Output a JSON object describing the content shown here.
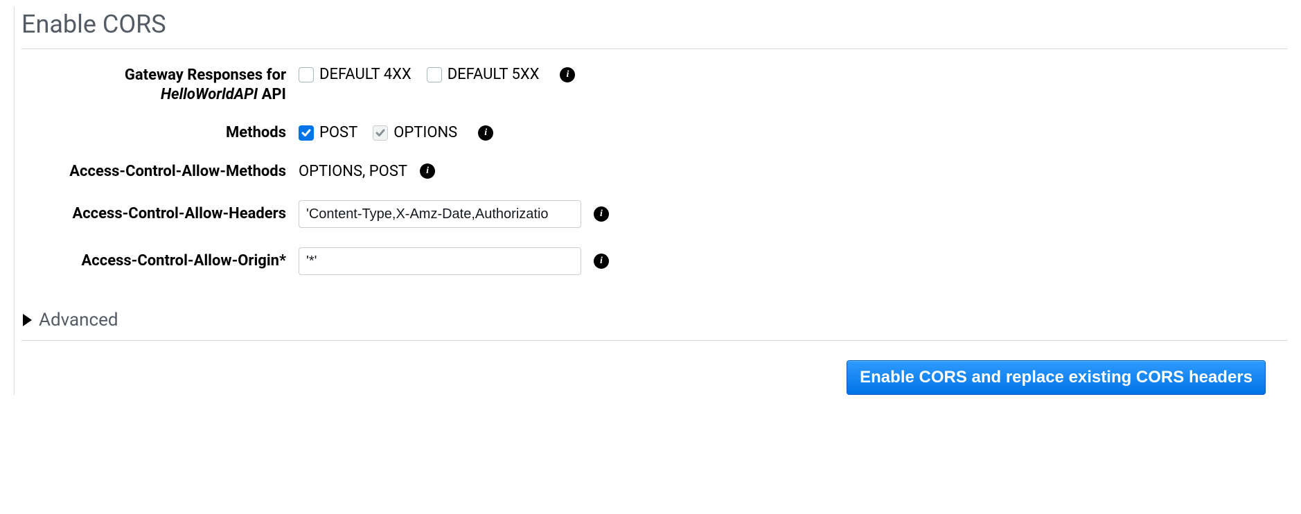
{
  "title": "Enable CORS",
  "labels": {
    "gateway_prefix": "Gateway Responses for ",
    "gateway_api_name": "HelloWorldAPI",
    "gateway_suffix": " API",
    "methods": "Methods",
    "allow_methods": "Access-Control-Allow-Methods",
    "allow_headers": "Access-Control-Allow-Headers",
    "allow_origin": "Access-Control-Allow-Origin*",
    "advanced": "Advanced"
  },
  "gateway_responses": {
    "default_4xx": {
      "label": "DEFAULT 4XX",
      "checked": false
    },
    "default_5xx": {
      "label": "DEFAULT 5XX",
      "checked": false
    }
  },
  "methods": {
    "post": {
      "label": "POST",
      "checked": true
    },
    "options": {
      "label": "OPTIONS",
      "checked": true,
      "disabled": true
    }
  },
  "values": {
    "allow_methods_text": "OPTIONS, POST",
    "allow_headers_input": "'Content-Type,X-Amz-Date,Authorizatio",
    "allow_origin_input": "'*'"
  },
  "button": {
    "submit": "Enable CORS and replace existing CORS headers"
  }
}
